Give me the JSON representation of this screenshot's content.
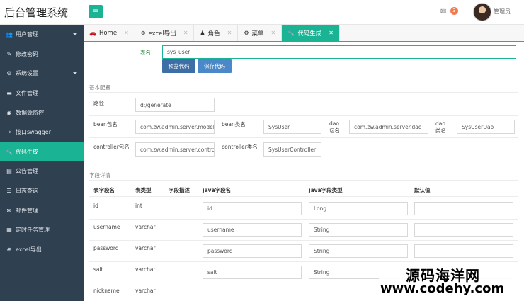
{
  "app": {
    "title": "后台管理系统",
    "menu_toggle_icon": "hamburger-icon"
  },
  "header": {
    "mail_icon": "envelope-icon",
    "mail_count": "3",
    "user_name": "管理员"
  },
  "sidebar": {
    "items": [
      {
        "label": "用户管理",
        "icon": "users-icon",
        "has_caret": true
      },
      {
        "label": "修改密码",
        "icon": "pencil-icon"
      },
      {
        "label": "系统设置",
        "icon": "gears-icon",
        "has_caret": true
      },
      {
        "label": "文件管理",
        "icon": "folder-icon"
      },
      {
        "label": "数据源监控",
        "icon": "eye-icon"
      },
      {
        "label": "接口swagger",
        "icon": "export-icon"
      },
      {
        "label": "代码生成",
        "icon": "wrench-icon",
        "active": true
      },
      {
        "label": "公告管理",
        "icon": "book-icon"
      },
      {
        "label": "日志查询",
        "icon": "list-icon"
      },
      {
        "label": "邮件管理",
        "icon": "envelope-icon"
      },
      {
        "label": "定时任务管理",
        "icon": "tasks-icon"
      },
      {
        "label": "excel导出",
        "icon": "plus-circle-icon"
      }
    ]
  },
  "tabs": [
    {
      "label": "Home",
      "icon": "car-icon"
    },
    {
      "label": "excel导出",
      "icon": "plus-circle-icon"
    },
    {
      "label": "角色",
      "icon": "user-secret-icon"
    },
    {
      "label": "菜单",
      "icon": "gear-icon"
    },
    {
      "label": "代码生成",
      "icon": "wrench-icon",
      "active": true
    }
  ],
  "form": {
    "table_label": "表名",
    "table_value": "sys_user",
    "preview_button": "预览代码",
    "save_button": "保存代码",
    "basic_section": "基本配置",
    "path_label": "路径",
    "path_value": "d:/generate",
    "bean_pkg_label": "bean包名",
    "bean_pkg_value": "com.zw.admin.server.model",
    "bean_class_label": "bean类名",
    "bean_class_value": "SysUser",
    "dao_pkg_label_1": "dao",
    "dao_pkg_label_2": "包名",
    "dao_pkg_value": "com.zw.admin.server.dao",
    "dao_class_label_1": "dao",
    "dao_class_label_2": "类名",
    "dao_class_value": "SysUserDao",
    "controller_pkg_label": "controller包名",
    "controller_pkg_value": "com.zw.admin.server.controller",
    "controller_class_label": "controller类名",
    "controller_class_value": "SysUserController",
    "fields_section": "字段详情"
  },
  "fields_table": {
    "headers": [
      "表字段名",
      "表类型",
      "字段描述",
      "java字段名",
      "java字段类型",
      "默认值"
    ],
    "rows": [
      {
        "column": "id",
        "type": "int",
        "java_name": "id",
        "java_type": "Long",
        "default": ""
      },
      {
        "column": "username",
        "type": "varchar",
        "java_name": "username",
        "java_type": "String",
        "default": ""
      },
      {
        "column": "password",
        "type": "varchar",
        "java_name": "password",
        "java_type": "String",
        "default": ""
      },
      {
        "column": "salt",
        "type": "varchar",
        "java_name": "salt",
        "java_type": "String",
        "default": ""
      },
      {
        "column": "nickname",
        "type": "varchar",
        "java_name": "",
        "java_type": "",
        "default": ""
      }
    ]
  },
  "watermark": {
    "line1": "源码海洋网",
    "line2": "www.codehy.com"
  }
}
